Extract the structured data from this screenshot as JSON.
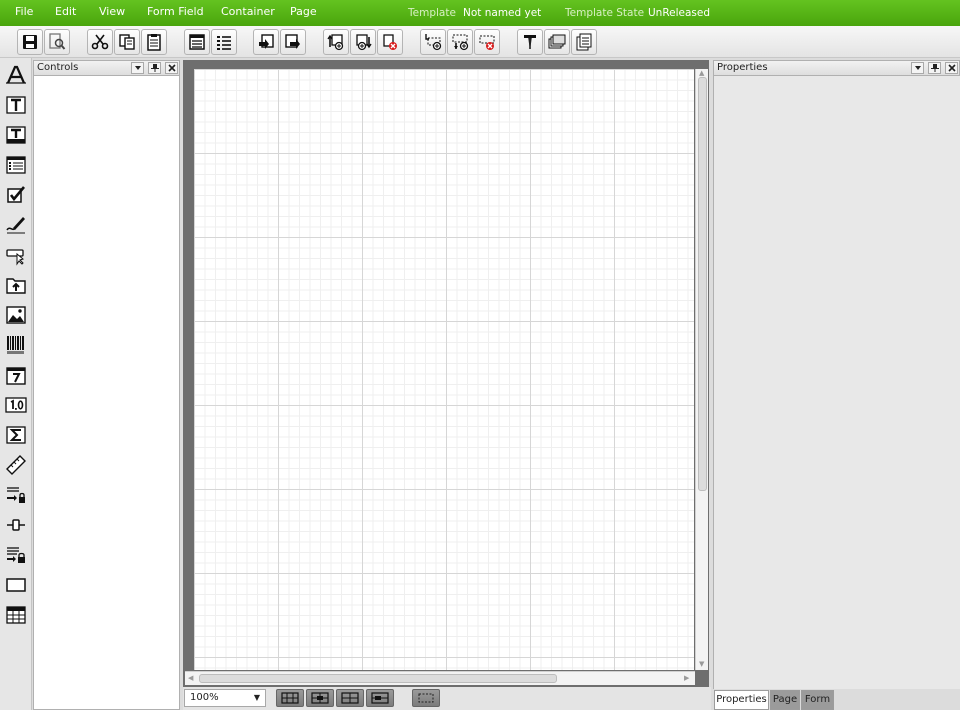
{
  "menubar": {
    "menus": [
      "File",
      "Edit",
      "View",
      "Form Field",
      "Container",
      "Page"
    ],
    "template_label": "Template",
    "template_value": "Not named yet",
    "state_label": "Template State",
    "state_value": "UnReleased"
  },
  "toolbar": {
    "buttons": [
      "save-icon",
      "preview-icon",
      "cut-icon",
      "copy-icon",
      "paste-icon",
      "form-layout-icon",
      "list-layout-icon",
      "import-icon",
      "export-icon",
      "add-field-before-icon",
      "add-field-after-icon",
      "delete-field-icon",
      "add-row-before-icon",
      "add-row-after-icon",
      "delete-row-icon",
      "style-icon",
      "stack-icon",
      "pages-icon"
    ]
  },
  "palette": {
    "items": [
      "label-icon",
      "textbox-icon",
      "textarea-icon",
      "listbox-icon",
      "checkbox-icon",
      "signature-icon",
      "button-icon",
      "upload-icon",
      "image-icon",
      "barcode-icon",
      "calendar-icon",
      "numeric-icon",
      "sum-icon",
      "ruler-icon",
      "field-lock-icon",
      "slider-icon",
      "group-lock-icon",
      "rectangle-icon",
      "grid-icon"
    ]
  },
  "controls_panel": {
    "title": "Controls"
  },
  "properties_panel": {
    "title": "Properties"
  },
  "zoom": {
    "value": "100%"
  },
  "tabs": [
    "Properties",
    "Page",
    "Form"
  ],
  "colors": {
    "accent": "#5ab71a",
    "canvas_frame": "#6e6e6e"
  }
}
